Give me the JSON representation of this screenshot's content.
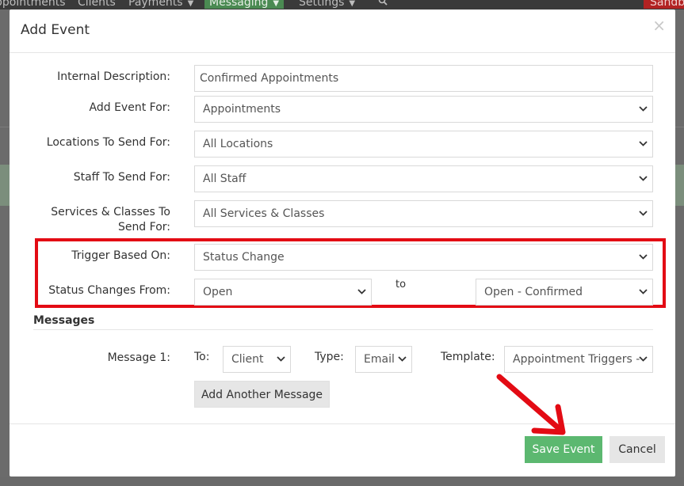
{
  "nav": {
    "items": [
      "ppointments",
      "Clients",
      "Payments",
      "Messaging",
      "Settings"
    ],
    "sandbox": "Sandbo"
  },
  "modal": {
    "title": "Add Event",
    "close_symbol": "×"
  },
  "form": {
    "internal_description": {
      "label": "Internal Description:",
      "value": "Confirmed Appointments"
    },
    "add_event_for": {
      "label": "Add Event For:",
      "value": "Appointments"
    },
    "locations": {
      "label": "Locations To Send For:",
      "value": "All Locations"
    },
    "staff": {
      "label": "Staff To Send For:",
      "value": "All Staff"
    },
    "services": {
      "label": "Services & Classes To Send For:",
      "value": "All Services & Classes"
    },
    "trigger": {
      "label": "Trigger Based On:",
      "value": "Status Change"
    },
    "status_change": {
      "label": "Status Changes From:",
      "from_value": "Open",
      "to_label": "to",
      "to_value": "Open - Confirmed"
    }
  },
  "messages": {
    "section_title": "Messages",
    "message_label": "Message 1:",
    "to_label": "To:",
    "to_value": "Client",
    "type_label": "Type:",
    "type_value": "Email",
    "template_label": "Template:",
    "template_value": "Appointment Triggers - De",
    "add_button": "Add Another Message"
  },
  "footer": {
    "save_button": "Save Event",
    "cancel_button": "Cancel"
  },
  "colors": {
    "highlight_border": "#e30b14",
    "save_green": "#5cb870",
    "annotation_arrow": "#e30b14"
  }
}
